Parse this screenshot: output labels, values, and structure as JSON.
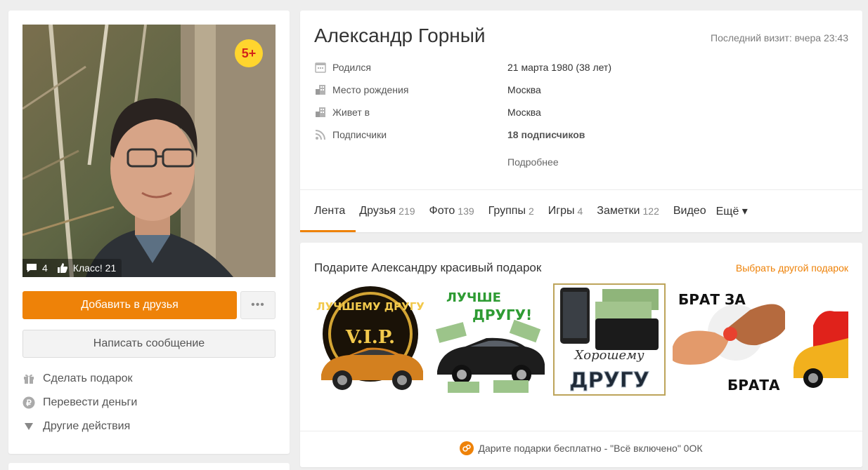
{
  "profile": {
    "name": "Александр Горный",
    "last_visit": "Последний визит: вчера 23:43",
    "age_badge": "5+",
    "photo_comments": "4",
    "photo_likes": "Класс! 21"
  },
  "buttons": {
    "add_friend": "Добавить в друзья",
    "more": "•••",
    "message": "Написать сообщение"
  },
  "actions": [
    {
      "label": "Сделать подарок",
      "icon": "gift-icon"
    },
    {
      "label": "Перевести деньги",
      "icon": "ruble-icon"
    },
    {
      "label": "Другие действия",
      "icon": "triangle-down-icon"
    }
  ],
  "info": [
    {
      "label": "Родился",
      "value": "21 марта 1980 (38 лет)",
      "icon": "calendar-icon"
    },
    {
      "label": "Место рождения",
      "value": "Москва",
      "icon": "building-icon"
    },
    {
      "label": "Живет в",
      "value": "Москва",
      "icon": "building-icon"
    },
    {
      "label": "Подписчики",
      "value": "18 подписчиков",
      "icon": "rss-icon"
    }
  ],
  "more_link": "Подробнее",
  "tabs": [
    {
      "label": "Лента",
      "count": "",
      "active": true
    },
    {
      "label": "Друзья",
      "count": "219"
    },
    {
      "label": "Фото",
      "count": "139"
    },
    {
      "label": "Группы",
      "count": "2"
    },
    {
      "label": "Игры",
      "count": "4"
    },
    {
      "label": "Заметки",
      "count": "122"
    },
    {
      "label": "Видео",
      "count": ""
    },
    {
      "label": "Ещё ▾",
      "count": ""
    }
  ],
  "gifts": {
    "title": "Подарите Александру красивый подарок",
    "other_link": "Выбрать другой подарок",
    "footer": "Дарите подарки бесплатно - \"Всё включено\" 0ОК",
    "items": [
      {
        "text_top": "ЛУЧШЕМУ ДРУГУ",
        "text_mid": "V.I.P."
      },
      {
        "text_top": "ЛУЧШЕ",
        "text_mid": "ДРУГУ!"
      },
      {
        "text_top": "Хорошему",
        "text_mid": "ДРУГУ"
      },
      {
        "text_top": "БРАТ ЗА",
        "text_mid": "БРАТА"
      },
      {
        "text_top": "",
        "text_mid": ""
      }
    ]
  },
  "colors": {
    "accent": "#ee8208",
    "badge": "#ffd52e"
  }
}
